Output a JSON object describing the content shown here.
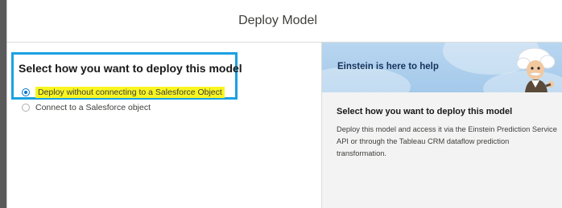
{
  "modal": {
    "title": "Deploy Model"
  },
  "deploy_options": {
    "heading": "Select how you want to deploy this model",
    "options": [
      {
        "label": "Deploy without connecting to a Salesforce Object",
        "selected": true,
        "highlight_color": "#f8f520"
      },
      {
        "label": "Connect to a Salesforce object",
        "selected": false
      }
    ]
  },
  "help_panel": {
    "banner_title": "Einstein is here to help",
    "body_title": "Select how you want to deploy this model",
    "body_text": "Deploy this model and access it via the Einstein Prediction Service API or through the Tableau CRM dataflow prediction transformation."
  },
  "colors": {
    "focus_border": "#1ba1e2",
    "radio_selected": "#0176d3",
    "banner_bg": "#a4c9ea",
    "panel_bg": "#f3f3f3"
  },
  "icons": {
    "mascot": "einstein-mascot-icon"
  }
}
